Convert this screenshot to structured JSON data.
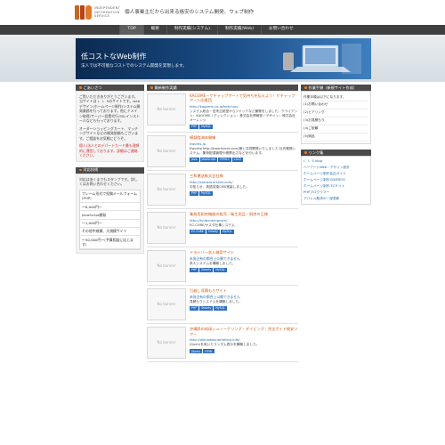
{
  "header": {
    "logo_text_lines": [
      "INDEPENDENT",
      "INFORMATION",
      "SERVICE"
    ],
    "tagline": "個人事業主だから出来る格安のシステム開発、ウェブ制作"
  },
  "nav": {
    "items": [
      {
        "label": "TOP",
        "active": true
      },
      {
        "label": "概要",
        "active": false
      },
      {
        "label": "制作実績(システム)",
        "active": false
      },
      {
        "label": "制作実績(Web)",
        "active": false
      },
      {
        "label": "お問い合わせ",
        "active": false
      }
    ]
  },
  "hero": {
    "title": "低コストなWeb制作",
    "subtitle": "法人では不可能なコストでのシステム開発を実現します。"
  },
  "left": {
    "about_head": "ごあいさつ",
    "about_text": "ご覧いただきありがとうございます。当サイトは I．I．Sのサイトです。webデザイン/ホームページ制作/システム開発業務を行っております。他にドメイン取得/サーバー設置代行/SSLインストールなども行っております。",
    "about_text2": "オーダーショッピングカート、マッチングサイトなどの開発依頼もございます。ご相談をお気軽にどうぞ。",
    "about_red": "個人/法人とのデパートカード最も理想的に運営しております。詳細はご連絡ください。",
    "skill_head": "対応技術",
    "skill_text": "対応はあくまでもスタンプです。詳しくはお問い合わせください。",
    "skills": [
      "フレーム形式で投稿メールフォーム(PHP)",
      "〜8,000円〜",
      "JavaScript開発",
      "〜1,000円〜",
      "その他中規模、大規模サイト",
      "〜50,000円〜(予算相談に応じます)"
    ]
  },
  "center": {
    "head": "最新制作実績",
    "banner_text": "No banner",
    "entries": [
      {
        "title": "KAGOME－ケチャップアートで気持ちを伝えよう！ケチャップアート応援団",
        "url": "http://kagome.co.jp/ketchup/",
        "desc": "システム統合－旧来正統型からジャックなど兼業をしました。クライアント：KAGOME / ディレクション：株式会社博報堂 / デザイン：株式会社オーレンジ",
        "tags": [
          "PHP",
          "MySQL"
        ]
      },
      {
        "title": "模擬臨海体験機",
        "url": "kworks.jp",
        "desc": "Kworks(http://kworksnet.com)様と共同開発いたしました 社内業務システム。集荷配達管理や帳票出力などを行います。",
        "tags": [
          "Java",
          "JavaScript",
          "HTML5",
          "CSS3"
        ]
      },
      {
        "title": "三和運送株式会社様",
        "url": "http://sanwacorsnet.com/",
        "desc": "お知らせ、英語変換CMS実装しました。",
        "tags": [
          "PHP",
          "MySQL"
        ]
      },
      {
        "title": "業務用厨房機器の販売／衛生用品・厨房の王様",
        "url": "http://tyuboukingcom/",
        "desc": "EC-CUBE/ヤスダ仕事システム",
        "tags": [
          "EC-CUBE",
          "Smarty",
          "MySQL"
        ]
      },
      {
        "title": "ドライバー求人検索サイト",
        "url": "未発注有の都合上公開できません",
        "desc": "求人システムを構築しました。",
        "tags": [
          "PHP",
          "Smarty",
          "MySQL"
        ]
      },
      {
        "title": "引越し見積もりサイト",
        "url": "未発注有の都合上公開できません",
        "desc": "見積もりシステムを構築しました。",
        "tags": [
          "PHP",
          "Smarty",
          "MySQL"
        ]
      },
      {
        "title": "沖縄県の琉球シュノーケリング・ダイビング｜完全ガイド格安ツアー",
        "url": "http://okinawasnorkeling.info/",
        "desc": "jQueryを用いたランダム表示を構築しました。",
        "tags": [
          "jQuery",
          "HTML"
        ]
      }
    ]
  },
  "right": {
    "head": "作業手順（新規サイト作成）",
    "steps": [
      "作業手順は以下になります。",
      "(1)お問い合わせ",
      "(2)ヒアリング",
      "(3)お見積もり",
      "(4)ご依頼",
      "(5)納品"
    ],
    "links_head": "リンク集",
    "links": [
      "I．I．S blog",
      "ハーアートWeb・デザイン設計",
      "ホームページ制作会社ガイド",
      "ホームページ制作のWEBOS",
      "ホームページ制作 ECサイト",
      "PHPプログラマー",
      "アパレル販売の一部更新"
    ]
  }
}
